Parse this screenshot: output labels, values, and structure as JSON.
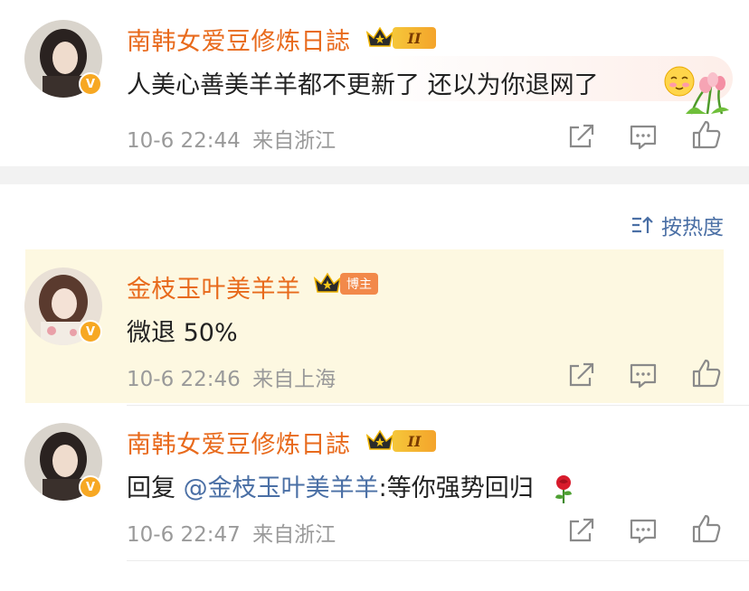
{
  "comments": [
    {
      "username": "南韩女爱豆修炼日誌",
      "level_badge": "II",
      "text": "人美心善美羊羊都不更新了 还以为你退网了",
      "date": "10-6 22:44",
      "location": "来自浙江"
    },
    {
      "username": "金枝玉叶美羊羊",
      "owner_badge": "博主",
      "text": "微退 50%",
      "date": "10-6 22:46",
      "location": "来自上海"
    },
    {
      "username": "南韩女爱豆修炼日誌",
      "level_badge": "II",
      "reply_prefix": "回复",
      "mention": "@金枝玉叶美羊羊",
      "reply_text": ":等你强势回归",
      "date": "10-6 22:47",
      "location": "来自浙江"
    }
  ],
  "sort": {
    "label": "按热度"
  },
  "colors": {
    "username": "#e86a1c",
    "link": "#4a6fa5",
    "meta": "#9a9a9a",
    "highlight_bg": "#fdf8e1",
    "verified": "#f7a823"
  },
  "icons": [
    "verified-icon",
    "crown-icon",
    "share-icon",
    "comment-icon",
    "like-icon",
    "sort-icon",
    "rose-icon",
    "blush-emoji-icon",
    "tulip-icon"
  ]
}
